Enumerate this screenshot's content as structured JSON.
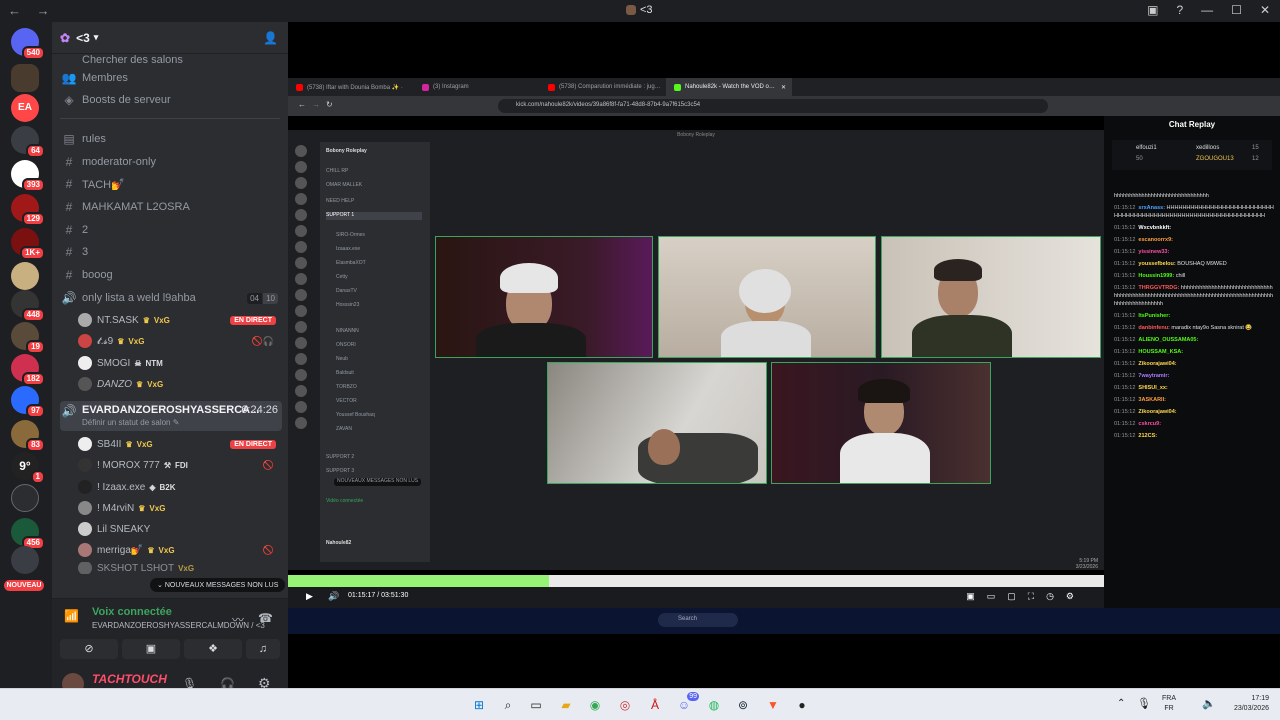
{
  "window": {
    "title": "<3",
    "title_icon": "server-avatar-icon"
  },
  "server_rail": {
    "badges": [
      "540",
      "64",
      "393",
      "129",
      "1K+",
      "448",
      "19",
      "182",
      "97",
      "83",
      "1",
      "456"
    ],
    "new_label": "NOUVEAU"
  },
  "server": {
    "name": "<3",
    "items": [
      {
        "icon": "search",
        "label": "Chercher des salons"
      },
      {
        "icon": "members",
        "label": "Membres"
      },
      {
        "icon": "boost",
        "label": "Boosts de serveur"
      }
    ]
  },
  "channels": [
    {
      "type": "text",
      "label": "rules"
    },
    {
      "type": "text",
      "label": "moderator-only"
    },
    {
      "type": "text",
      "label": "TACH💅"
    },
    {
      "type": "text",
      "label": "MAHKAMAT L2OSRA"
    },
    {
      "type": "text",
      "label": "2"
    },
    {
      "type": "text",
      "label": "3"
    },
    {
      "type": "text",
      "label": "booog"
    }
  ],
  "voice_channel_1": {
    "label": "only lista a weld l9ahba",
    "count": "04",
    "limit": "10",
    "users": [
      {
        "name": "NT.SASK",
        "tag": "VxG",
        "live": "EN DIRECT"
      },
      {
        "name": "𝓽.𝓼9",
        "tag": "VxG"
      },
      {
        "name": "SMOGI",
        "tag": "NTM"
      },
      {
        "name": "DANZO",
        "tag": "VxG"
      }
    ]
  },
  "voice_channel_2": {
    "label": "EVARDANZOEROSHYASSERCA...",
    "timer": "6:24:26",
    "status": "Définir un statut de salon",
    "users": [
      {
        "name": "SB4II",
        "tag": "VxG",
        "live": "EN DIRECT"
      },
      {
        "name": "! MOROX 777",
        "tag": "FDI"
      },
      {
        "name": "! Izaax.exe",
        "tag": "B2K"
      },
      {
        "name": "! M4rviN",
        "tag": "VxG"
      },
      {
        "name": "Lil SNEAKY",
        "tag": ""
      },
      {
        "name": "merriga💅",
        "tag": "VxG"
      },
      {
        "name": "SKSHOT LSHOT",
        "tag": "VxG"
      }
    ]
  },
  "new_messages_banner": "NOUVEAUX MESSAGES NON LUS",
  "voice_status": {
    "title": "Voix connectée",
    "channel": "EVARDANZOEROSHYASSERCALMDOWN / <3"
  },
  "user_panel": {
    "display_name": "TACHTOUCH",
    "username": "tachtouch"
  },
  "browser": {
    "tabs": [
      {
        "label": "(5738) Iftar with Dounia Bomba ✨ ·",
        "color": "#ff0000"
      },
      {
        "label": "(3) Instagram",
        "color": "#d6249f"
      },
      {
        "label": "(5738) Comparution immédiate : jug…",
        "color": "#ff0000"
      },
      {
        "label": "Nahoule82k - Watch the VOD o…",
        "color": "#53fc18"
      }
    ],
    "url": "kick.com/nahoule82k/videos/39a86f8f-fa71-48d8-87b4-9a7f615c3c54",
    "video": {
      "inner_title": "Bobony Roleplay",
      "server_name": "Bobony Roleplay",
      "current_time": "01:15:17",
      "duration": "03:51:30",
      "progress": 0.32,
      "inner_channels": [
        "CHILL RP",
        "OMAR MALLEK",
        "NEED HELP",
        "SUPPORT 1",
        "SUPPORT 2",
        "SUPPORT 3"
      ],
      "inner_users": [
        "SIRO-Ormes",
        "Izaaax.exe",
        "ElasmbaXOT",
        "Cetty",
        "DanasTV",
        "Hosssin23",
        "NINANNN",
        "ONSORI",
        "Neub",
        "Baldsuit",
        "TORBZO",
        "VECTOR",
        "Youssef Boushaq",
        "ZAVAN"
      ],
      "inner_user": "Nahoule82",
      "inner_connected": "Vidéo connectée",
      "inner_new_label": "NOUVEAUX MESSAGES NON LUS",
      "inner_clock": "5:19 PM",
      "inner_date": "3/23/2026",
      "inner_search": "Search"
    },
    "chat": {
      "title": "Chat Replay",
      "leaderboard": [
        {
          "name": "elfouzi1",
          "value": "50"
        },
        {
          "name": "xedilloos",
          "value": "15"
        },
        {
          "name": "ZGOUGOU13",
          "value": "12"
        }
      ],
      "messages": [
        {
          "time": "",
          "user": "",
          "color": "#e0e0e0",
          "text": "hhhhhhhhhhhhhhhhhhhhhhhhhhhhhhh"
        },
        {
          "time": "01:15:12",
          "user": "srxAnass:",
          "color": "#4fa3ff",
          "text": "HHHHHHHHHHHHHHHHHHHHHHHHHHHHHHHHHHHHHHHHHHHHHHHHHHHHHHHHHHHHHHHHH"
        },
        {
          "time": "01:15:12",
          "user": "Wxcvbnkkft:",
          "color": "#ffffff",
          "text": ""
        },
        {
          "time": "01:15:12",
          "user": "escanoorrx9:",
          "color": "#ff9f40",
          "text": ""
        },
        {
          "time": "01:15:12",
          "user": "yissinew33:",
          "color": "#ff4fa3",
          "text": ""
        },
        {
          "time": "01:15:12",
          "user": "youssefbelou:",
          "color": "#ffd84f",
          "text": "BOUSHAQ M9WED"
        },
        {
          "time": "01:15:12",
          "user": "Houssin1999:",
          "color": "#53fc18",
          "text": "chill"
        },
        {
          "time": "01:15:12",
          "user": "THRGGVTRDG:",
          "color": "#ff5a5a",
          "text": "hhhhhhhhhhhhhhhhhhhhhhhhhhhhhhhhhhhhhhhhhhhhhhhhhhhhhhhhhhhhhhhhhhhhhhhhhhhhhhhhhhhhhhhhhhhhhhhhhh"
        },
        {
          "time": "01:15:12",
          "user": "ItsPunisher:",
          "color": "#53fc18",
          "text": ""
        },
        {
          "time": "01:15:12",
          "user": "danbinfenu:",
          "color": "#ff5a5a",
          "text": "maradix ntay9o Sasna sknirat 😂"
        },
        {
          "time": "01:15:12",
          "user": "ALIENO_OUSSAMA05:",
          "color": "#53fc18",
          "text": ""
        },
        {
          "time": "01:15:12",
          "user": "HOUSSAM_KSA:",
          "color": "#53fc18",
          "text": ""
        },
        {
          "time": "01:15:12",
          "user": "Zikoorajawi04:",
          "color": "#ffd84f",
          "text": ""
        },
        {
          "time": "01:15:12",
          "user": "7waytramir:",
          "color": "#b07bff",
          "text": ""
        },
        {
          "time": "01:15:12",
          "user": "SHISUI_xx:",
          "color": "#ffd84f",
          "text": ""
        },
        {
          "time": "01:15:12",
          "user": "3ASKARII:",
          "color": "#ff9f40",
          "text": ""
        },
        {
          "time": "01:15:12",
          "user": "Zikoorajawi04:",
          "color": "#ffd84f",
          "text": ""
        },
        {
          "time": "01:15:12",
          "user": "cskrcu9:",
          "color": "#ff4fa3",
          "text": ""
        },
        {
          "time": "01:15:12",
          "user": "212CS:",
          "color": "#ffd84f",
          "text": ""
        }
      ]
    }
  },
  "taskbar": {
    "icons": [
      "windows-start-icon",
      "search-icon",
      "task-view-icon",
      "file-explorer-icon",
      "chrome-icon",
      "steam-like-icon",
      "pdf-icon",
      "discord-icon",
      "spotify-icon",
      "steam-icon",
      "brave-icon",
      "obs-icon"
    ],
    "discord_badge": "99",
    "lang_top": "FRA",
    "lang_bottom": "FR",
    "clock": "17:19",
    "date": "23/03/2026"
  }
}
